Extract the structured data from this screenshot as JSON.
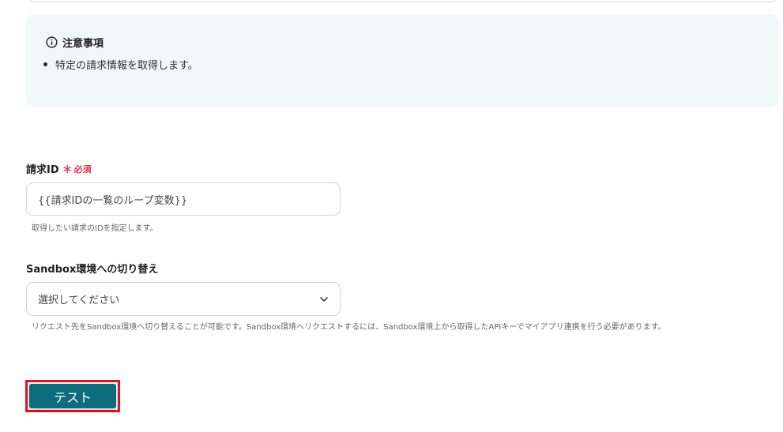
{
  "notice": {
    "title": "注意事項",
    "items": [
      "特定の請求情報を取得します。"
    ]
  },
  "invoice_id": {
    "label": "請求ID",
    "required_mark": "＊",
    "required_text": "必須",
    "value": "{{請求IDの一覧のループ変数}}",
    "help": "取得したい請求のIDを指定します。"
  },
  "sandbox": {
    "label": "Sandbox環境への切り替え",
    "selected": "選択してください",
    "help": "リクエスト先をSandbox環境へ切り替えることが可能です。Sandbox環境へリクエストするには、Sandbox環境上から取得したAPIキーでマイアプリ連携を行う必要があります。"
  },
  "actions": {
    "test_label": "テスト"
  },
  "colors": {
    "notice_bg": "#f1f9f8",
    "required": "#e0344a",
    "button_bg": "#0d6b7e",
    "highlight": "#e0161f"
  },
  "icons": {
    "info": "info-circle-icon",
    "chevron": "chevron-down-icon"
  }
}
